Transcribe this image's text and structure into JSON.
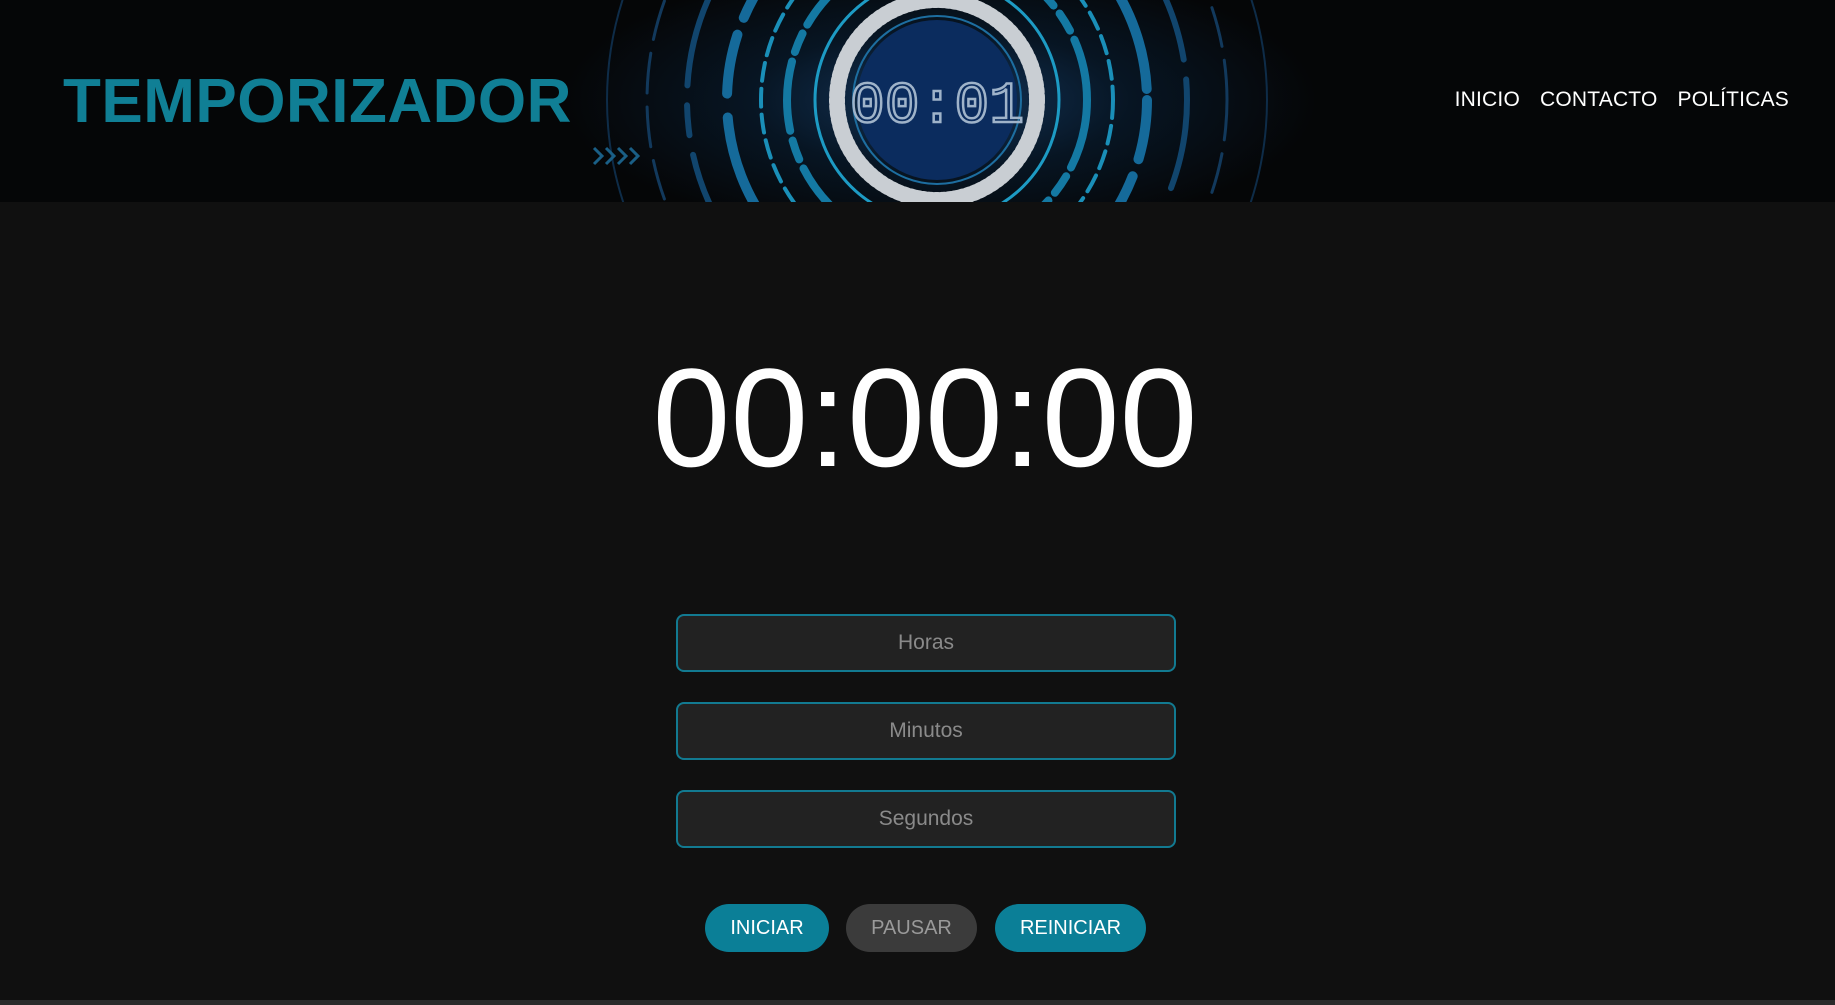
{
  "header": {
    "logo": "TEMPORIZADOR",
    "banner_readout": "00:01",
    "nav": [
      {
        "label": "INICIO"
      },
      {
        "label": "CONTACTO"
      },
      {
        "label": "POLÍTICAS"
      }
    ]
  },
  "timer": {
    "display": "00:00:00"
  },
  "inputs": {
    "hours_placeholder": "Horas",
    "minutes_placeholder": "Minutos",
    "seconds_placeholder": "Segundos"
  },
  "buttons": {
    "start": "INICIAR",
    "pause": "PAUSAR",
    "reset": "REINICIAR"
  },
  "colors": {
    "accent": "#0b7f97",
    "logo": "#107f95",
    "background": "#101010",
    "header_background": "#050607",
    "button_disabled": "#3b3b3b"
  }
}
